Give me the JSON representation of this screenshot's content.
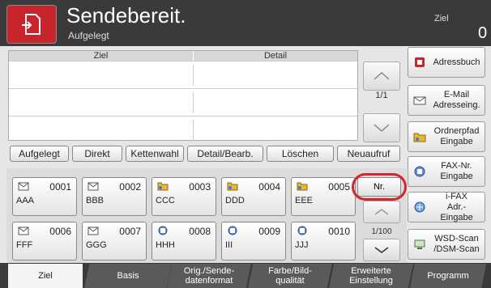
{
  "header": {
    "title": "Sendebereit.",
    "subtitle": "Aufgelegt",
    "target_label": "Ziel",
    "target_count": "0"
  },
  "dest_list": {
    "col_target": "Ziel",
    "col_detail": "Detail",
    "page": "1/1"
  },
  "side_buttons": {
    "address_book": "Adressbuch",
    "email": [
      "E-Mail",
      "Adresseing."
    ],
    "folder": [
      "Ordnerpfad",
      "Eingabe"
    ],
    "fax": [
      "FAX-Nr.",
      "Eingabe"
    ],
    "ifax": [
      "i-FAX",
      "Adr.-Eingabe"
    ],
    "wsd": [
      "WSD-Scan",
      "/DSM-Scan"
    ]
  },
  "mid_buttons": {
    "on_hook": "Aufgelegt",
    "direct": "Direkt",
    "chain": "Kettenwahl",
    "detail_edit": "Detail/Bearb.",
    "delete": "Löschen",
    "recall": "Neuaufruf"
  },
  "one_touch": [
    {
      "num": "0001",
      "name": "AAA",
      "icon": "mail-icon"
    },
    {
      "num": "0002",
      "name": "BBB",
      "icon": "mail-icon"
    },
    {
      "num": "0003",
      "name": "CCC",
      "icon": "folder-icon"
    },
    {
      "num": "0004",
      "name": "DDD",
      "icon": "folder-icon"
    },
    {
      "num": "0005",
      "name": "EEE",
      "icon": "folder-icon"
    },
    {
      "num": "0006",
      "name": "FFF",
      "icon": "mail-icon"
    },
    {
      "num": "0007",
      "name": "GGG",
      "icon": "mail-icon"
    },
    {
      "num": "0008",
      "name": "HHH",
      "icon": "fax-icon"
    },
    {
      "num": "0009",
      "name": "III",
      "icon": "fax-icon"
    },
    {
      "num": "0010",
      "name": "JJJ",
      "icon": "fax-icon"
    }
  ],
  "one_touch_nr": "Nr.",
  "one_touch_page": "1/100",
  "tabs": [
    {
      "label": "Ziel",
      "label2": ""
    },
    {
      "label": "Basis",
      "label2": ""
    },
    {
      "label": "Orig./Sende-",
      "label2": "datenformat"
    },
    {
      "label": "Farbe/Bild-",
      "label2": "qualität"
    },
    {
      "label": "Erweiterte",
      "label2": "Einstellung"
    },
    {
      "label": "Programm",
      "label2": ""
    }
  ],
  "colors": {
    "accent": "#c8242b",
    "header_bg": "#3a3a3a"
  }
}
